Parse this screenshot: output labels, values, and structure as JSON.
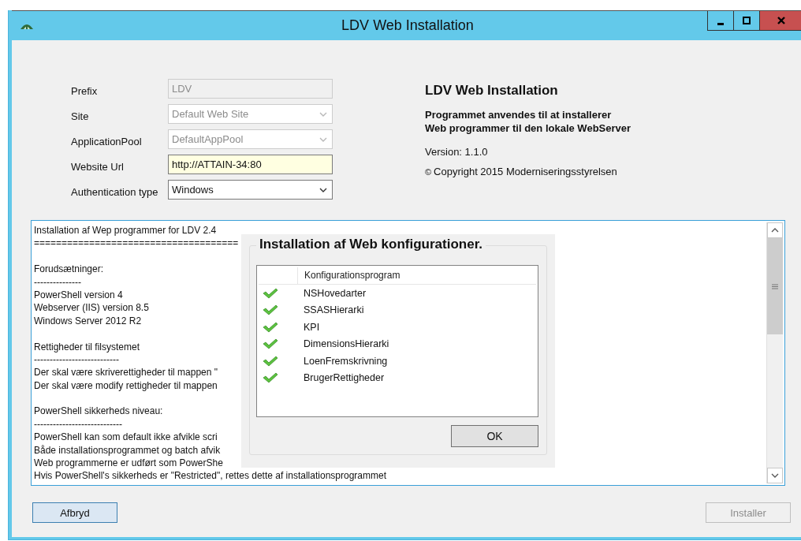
{
  "window": {
    "title": "LDV Web Installation"
  },
  "form": [
    {
      "label": "Prefix",
      "kind": "text",
      "value": "LDV",
      "disabled": true,
      "highlighted": false
    },
    {
      "label": "Site",
      "kind": "combo",
      "value": "Default Web Site",
      "disabled": true,
      "highlighted": false
    },
    {
      "label": "ApplicationPool",
      "kind": "combo",
      "value": "DefaultAppPool",
      "disabled": true,
      "highlighted": false
    },
    {
      "label": "Website Url",
      "kind": "text",
      "value": "http://ATTAIN-34:80",
      "disabled": false,
      "highlighted": true
    },
    {
      "label": "Authentication type",
      "kind": "combo",
      "value": "Windows",
      "disabled": false,
      "highlighted": false
    }
  ],
  "info": {
    "title": "LDV Web Installation",
    "description": [
      "Programmet anvendes til at installerer",
      "Web programmer til den lokale WebServer"
    ],
    "version": "Version: 1.1.0",
    "copyright_symbol": "©",
    "copyright": "Copyright 2015 Moderniseringsstyrelsen"
  },
  "log": [
    [
      "Installation af Wep programmer for LDV 2.4",
      "====================================="
    ],
    [
      "Forudsætninger:",
      "---------------",
      "PowerShell version 4",
      "Webserver (IIS) version 8.5",
      "Windows Server 2012 R2"
    ],
    [
      "Rettigheder til filsystemet",
      "---------------------------",
      "Der skal være skriverettigheder til mappen \"",
      "Der skal være modify rettigheder til mappen"
    ],
    [
      "PowerShell sikkerheds niveau:",
      "----------------------------",
      "PowerShell kan som default ikke afvikle scri",
      "Både installationsprogrammet og batch afvik",
      "Web programmerne er udført som PowerShe",
      "Hvis PowerShell's sikkerheds er \"Restricted\", rettes dette af installationsprogrammet"
    ]
  ],
  "dialog": {
    "title": "Installation af Web konfigurationer.",
    "column": "Konfigurationsprogram",
    "items": [
      {
        "name": "NSHovedarter",
        "done": true
      },
      {
        "name": "SSASHierarki",
        "done": true
      },
      {
        "name": "KPI",
        "done": true
      },
      {
        "name": "DimensionsHierarki",
        "done": true
      },
      {
        "name": "LoenFremskrivning",
        "done": true
      },
      {
        "name": "BrugerRettigheder",
        "done": true
      }
    ],
    "ok": "OK"
  },
  "buttons": [
    {
      "label": "Afbryd",
      "disabled": false
    },
    {
      "label": "Installer",
      "disabled": true
    }
  ]
}
